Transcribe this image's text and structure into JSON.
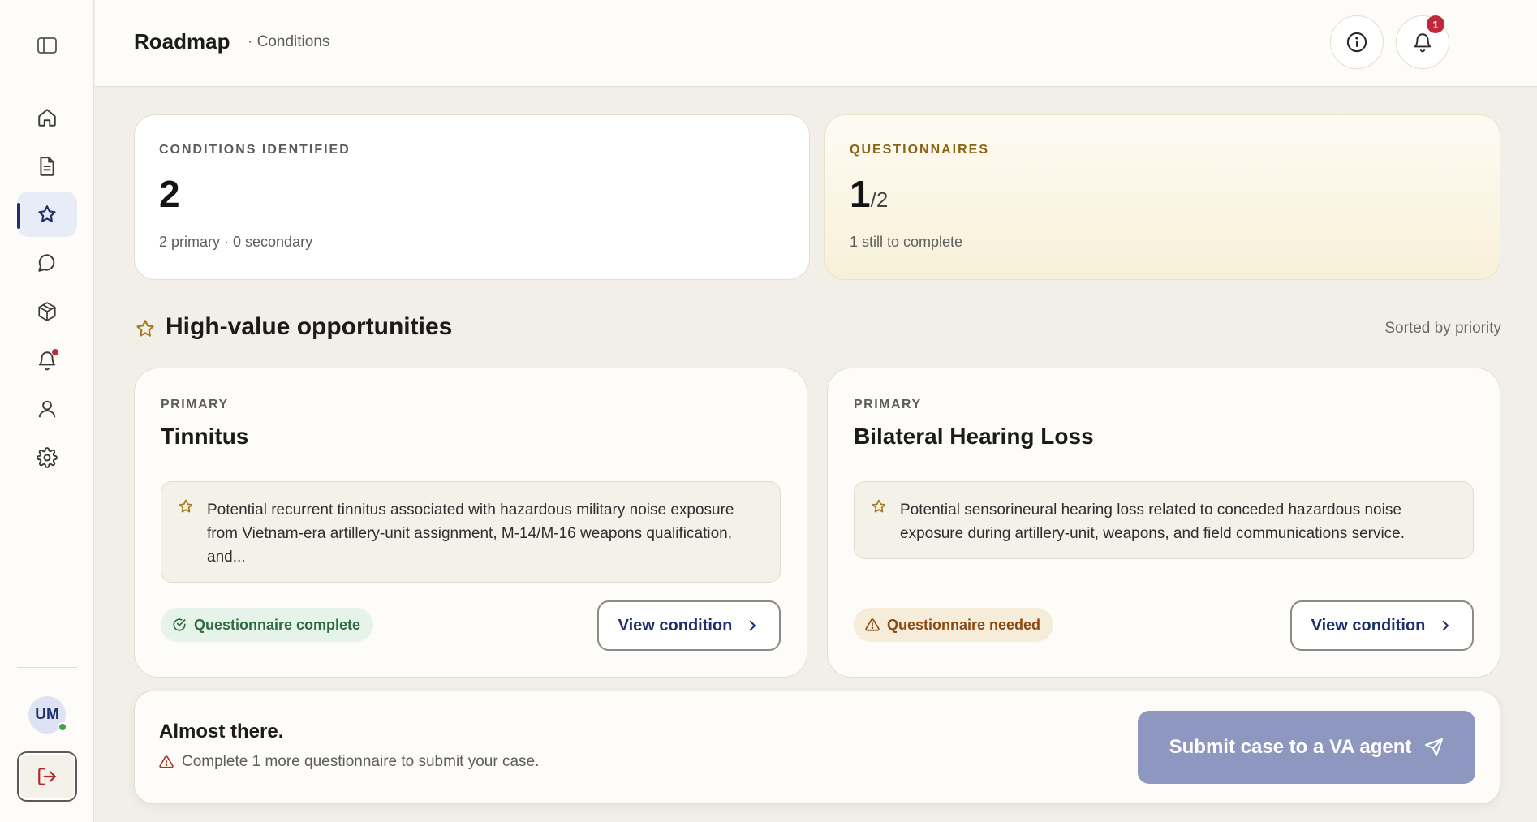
{
  "header": {
    "title": "Roadmap",
    "subtitle": "· Conditions",
    "notification_count": "1",
    "user_initials": "UM"
  },
  "sidebar": {
    "items": [
      {
        "icon": "home-icon"
      },
      {
        "icon": "document-icon"
      },
      {
        "icon": "star-icon",
        "active": true
      },
      {
        "icon": "chat-icon"
      },
      {
        "icon": "package-icon"
      },
      {
        "icon": "bell-icon",
        "has_alert": true
      },
      {
        "icon": "user-icon"
      },
      {
        "icon": "gear-icon"
      }
    ],
    "user_initials": "UM"
  },
  "stats": {
    "conditions": {
      "label": "CONDITIONS IDENTIFIED",
      "value": "2",
      "sub": "2 primary · 0 secondary"
    },
    "questionnaires": {
      "label": "QUESTIONNAIRES",
      "value": "1",
      "denominator": "/2",
      "sub": "1 still to complete"
    }
  },
  "section": {
    "title": "High-value opportunities",
    "sort_label": "Sorted by priority"
  },
  "opportunities": [
    {
      "kicker": "PRIMARY",
      "title": "Tinnitus",
      "description": "Potential recurrent tinnitus associated with hazardous military noise exposure from Vietnam-era artillery-unit assignment, M-14/M-16 weapons qualification, and...",
      "status": "Questionnaire complete",
      "button": "View condition"
    },
    {
      "kicker": "PRIMARY",
      "title": "Bilateral Hearing Loss",
      "description": "Potential sensorineural hearing loss related to conceded hazardous noise exposure during artillery-unit, weapons, and field communications service.",
      "status": "Questionnaire needed",
      "button": "View condition"
    }
  ],
  "footer": {
    "title": "Almost there.",
    "message": "Complete 1 more questionnaire to submit your case.",
    "submit_label": "Submit case to a VA agent"
  },
  "colors": {
    "accent": "#1f2f6b",
    "background": "#f2efe9",
    "alert": "#c2283c",
    "success": "#2e6b3f",
    "warning": "#8a4a12",
    "submit_disabled": "#8e97bf"
  }
}
